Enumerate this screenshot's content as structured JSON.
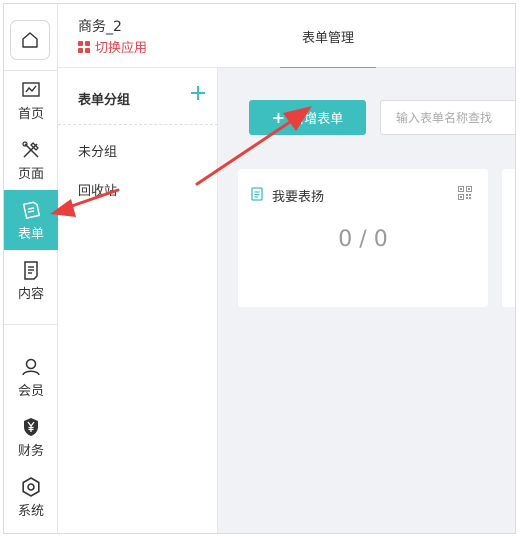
{
  "header": {
    "app_name": "商务_2",
    "switch_app": "切换应用",
    "tabs": [
      {
        "label": "表单管理"
      }
    ]
  },
  "rail": {
    "items": [
      {
        "label": "首页",
        "icon": "chart-icon"
      },
      {
        "label": "页面",
        "icon": "tools-icon"
      },
      {
        "label": "表单",
        "icon": "form-edit-icon",
        "active": true
      },
      {
        "label": "内容",
        "icon": "document-icon"
      },
      {
        "label": "会员",
        "icon": "user-icon"
      },
      {
        "label": "财务",
        "icon": "yen-icon"
      },
      {
        "label": "系统",
        "icon": "gear-icon"
      }
    ]
  },
  "groups": {
    "title": "表单分组",
    "items": [
      {
        "label": "未分组"
      },
      {
        "label": "回收站"
      }
    ]
  },
  "main": {
    "new_form_label": "新增表单",
    "search_placeholder": "输入表单名称查找",
    "cards": [
      {
        "title": "我要表扬",
        "count": "0 / 0"
      }
    ]
  },
  "colors": {
    "accent": "#3ebfbf",
    "switch_red": "#e0484c",
    "arrow_red": "#e8403c",
    "content_bg": "#f0f2f5"
  }
}
